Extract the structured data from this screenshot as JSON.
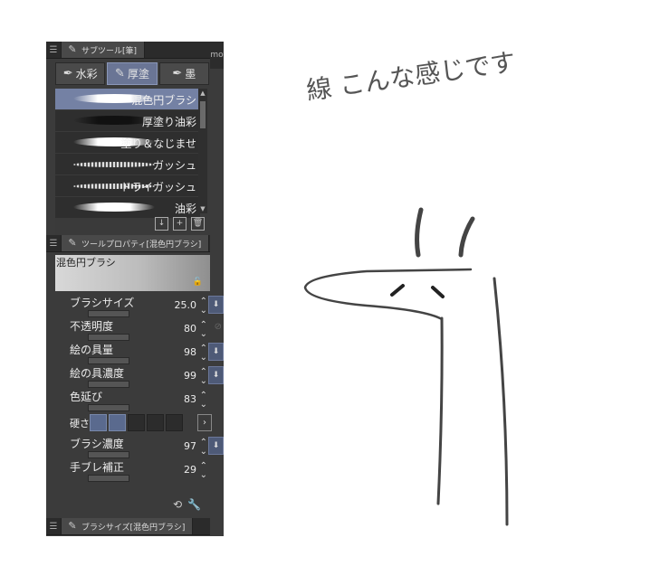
{
  "subtool_panel": {
    "title": "サブツール[筆]",
    "tabs": [
      {
        "label": "水彩",
        "active": false
      },
      {
        "label": "厚塗",
        "active": true
      },
      {
        "label": "墨",
        "active": false
      }
    ],
    "brushes": [
      {
        "name": "混色円ブラシ",
        "selected": true
      },
      {
        "name": "厚塗り油彩",
        "selected": false
      },
      {
        "name": "塗り＆なじませ",
        "selected": false
      },
      {
        "name": "ガッシュ",
        "selected": false
      },
      {
        "name": "ドライガッシュ",
        "selected": false
      },
      {
        "name": "油彩",
        "selected": false
      }
    ]
  },
  "tool_property_panel": {
    "title": "ツールプロパティ[混色円ブラシ]",
    "preview_name": "混色円ブラシ",
    "properties": [
      {
        "label": "ブラシサイズ",
        "value": "25.0"
      },
      {
        "label": "不透明度",
        "value": "80"
      },
      {
        "label": "絵の具量",
        "value": "98"
      },
      {
        "label": "絵の具濃度",
        "value": "99"
      },
      {
        "label": "色延び",
        "value": "83"
      }
    ],
    "hardness_label": "硬さ",
    "hardness_level": 2,
    "properties_b": [
      {
        "label": "ブラシ濃度",
        "value": "97"
      },
      {
        "label": "手ブレ補正",
        "value": "29"
      }
    ]
  },
  "brush_size_panel": {
    "title": "ブラシサイズ[混色円ブラシ]"
  },
  "right_strip_label": "mo",
  "canvas": {
    "handwritten_note": "線 こんな感じです"
  }
}
